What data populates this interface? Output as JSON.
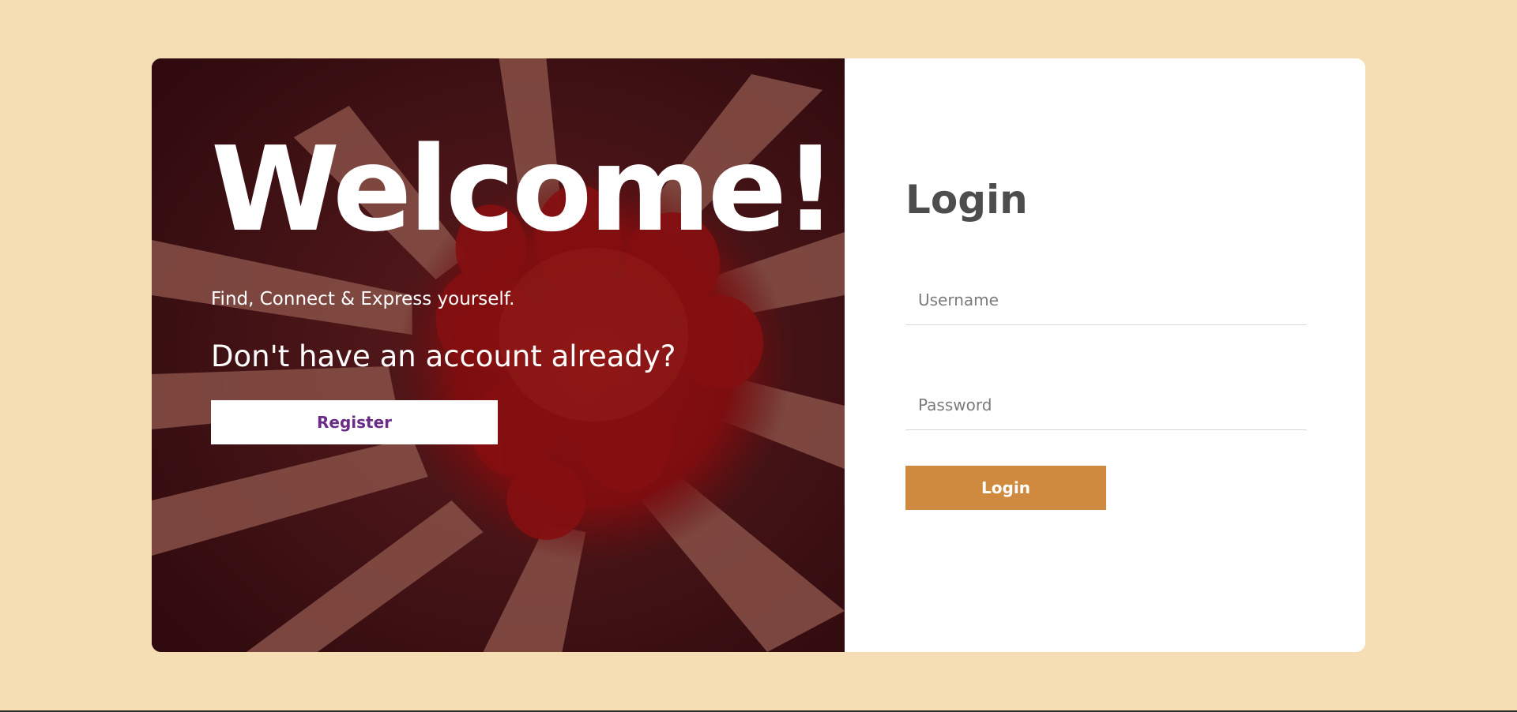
{
  "hero": {
    "title": "Welcome!",
    "tagline": "Find, Connect & Express yourself.",
    "no_account": "Don't have an account already?",
    "register_label": "Register"
  },
  "login": {
    "title": "Login",
    "username_placeholder": "Username",
    "password_placeholder": "Password",
    "username_value": "",
    "password_value": "",
    "submit_label": "Login"
  },
  "colors": {
    "page_background": "#f5deb3",
    "hero_tint": "#3d1417",
    "register_text": "#6a2c87",
    "login_button": "#d08a3f",
    "login_title": "#4d4d4d"
  }
}
